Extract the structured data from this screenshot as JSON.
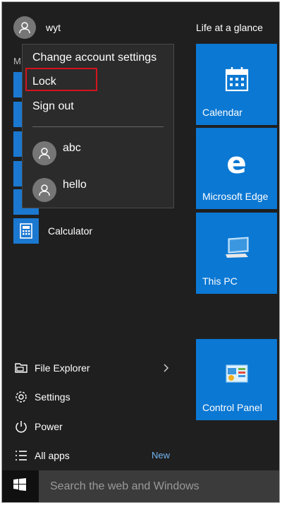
{
  "user": {
    "name": "wyt"
  },
  "section_letter": "M",
  "account_menu": {
    "change_settings": "Change account settings",
    "lock": "Lock",
    "sign_out": "Sign out",
    "other_users": [
      "abc",
      "hello"
    ]
  },
  "apps": {
    "calculator": "Calculator"
  },
  "bottom_menu": {
    "file_explorer": "File Explorer",
    "settings": "Settings",
    "power": "Power",
    "all_apps": "All apps",
    "new_badge": "New"
  },
  "tiles": {
    "header": "Life at a glance",
    "calendar": "Calendar",
    "edge": "Microsoft Edge",
    "this_pc": "This PC",
    "control_panel": "Control Panel"
  },
  "taskbar": {
    "search_placeholder": "Search the web and Windows"
  },
  "colors": {
    "tile_blue": "#0b78d3",
    "start_bg": "#1f1f1f",
    "highlight_red": "#d3141e",
    "new_badge": "#73b4f2"
  },
  "icons": {
    "start": "windows-logo-icon",
    "user": "user-avatar-icon",
    "calendar": "calendar-icon",
    "edge": "edge-icon",
    "this_pc": "computer-icon",
    "control_panel": "control-panel-icon",
    "file_explorer": "folder-icon",
    "settings": "gear-icon",
    "power": "power-icon",
    "all_apps": "list-icon",
    "calculator": "calculator-icon"
  }
}
